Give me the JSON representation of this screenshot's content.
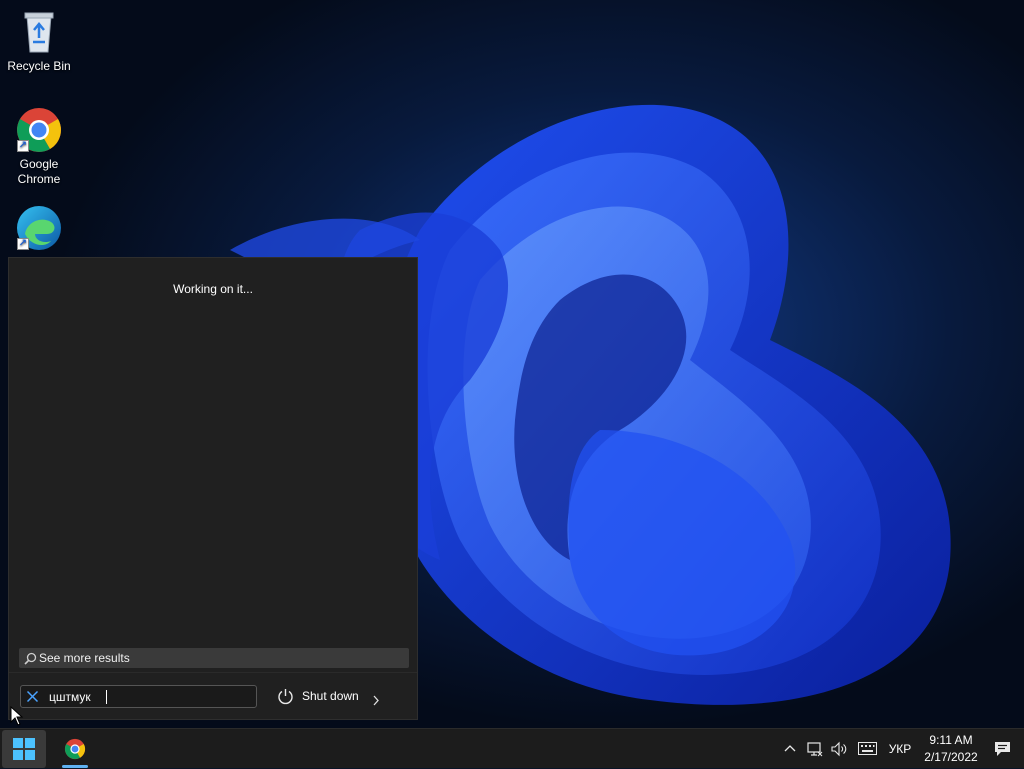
{
  "desktop": {
    "icons": [
      {
        "label": "Recycle Bin",
        "icon": "recycle-bin-icon"
      },
      {
        "label": "Google\nChrome",
        "icon": "chrome-icon"
      },
      {
        "label": "Microsoft Edge",
        "icon": "edge-icon"
      }
    ]
  },
  "start_panel": {
    "status_text": "Working on it...",
    "see_more_label": "See more results",
    "search": {
      "value": "цштмук",
      "clear_icon": "close-icon"
    },
    "shutdown_label": "Shut down"
  },
  "taskbar": {
    "start_icon": "windows-start-icon",
    "pinned": [
      {
        "name": "Google Chrome",
        "icon": "chrome-icon",
        "active": true
      }
    ],
    "tray": {
      "language": "УКР",
      "time": "9:11 AM",
      "date": "2/17/2022"
    }
  },
  "colors": {
    "panel_bg": "#202020",
    "taskbar_bg": "#1c1c1c",
    "accent": "#5fb2f2"
  }
}
